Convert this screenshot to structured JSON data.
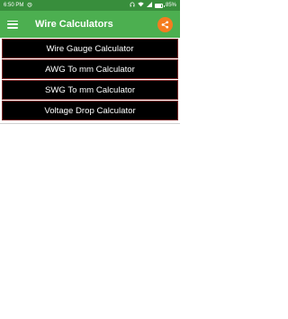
{
  "status_bar": {
    "time": "6:50 PM",
    "battery_percent": "85%",
    "battery_level": 0.85,
    "icons": [
      "alarm-icon",
      "headphones-icon",
      "wifi-icon",
      "signal-icon",
      "battery-icon"
    ]
  },
  "app_bar": {
    "title": "Wire Calculators",
    "menu_icon": "hamburger-menu-icon",
    "share_icon": "share-icon",
    "background_color": "#4caf50",
    "share_color": "#f57c1f"
  },
  "menu": {
    "items": [
      {
        "label": "Wire Gauge Calculator"
      },
      {
        "label": "AWG To mm Calculator"
      },
      {
        "label": "SWG To mm Calculator"
      },
      {
        "label": "Voltage Drop Calculator"
      }
    ],
    "item_background": "#000000",
    "item_border": "#7a2a2a"
  }
}
